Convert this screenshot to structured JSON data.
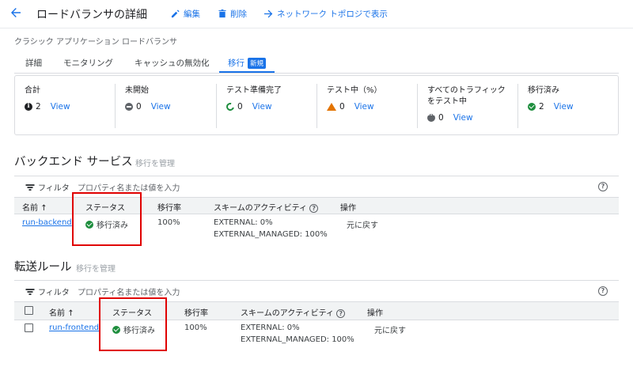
{
  "header": {
    "title": "ロードバランサの詳細",
    "edit_label": "編集",
    "delete_label": "削除",
    "topology_label": "ネットワーク トポロジで表示"
  },
  "subtitle": "クラシック アプリケーション ロードバランサ",
  "tabs": [
    {
      "label": "詳細"
    },
    {
      "label": "モニタリング"
    },
    {
      "label": "キャッシュの無効化"
    },
    {
      "label": "移行",
      "badge": "新規",
      "active": true
    }
  ],
  "summary": [
    {
      "title": "合計",
      "count": "2",
      "icon": "info-icon",
      "view": "View"
    },
    {
      "title": "未開始",
      "count": "0",
      "icon": "minus-circle-icon",
      "view": "View"
    },
    {
      "title": "テスト準備完了",
      "count": "0",
      "icon": "sync-icon",
      "view": "View"
    },
    {
      "title": "テスト中（%）",
      "count": "0",
      "icon": "warning-icon",
      "view": "View"
    },
    {
      "title_line1": "すべてのトラフィック",
      "title_line2": "をテスト中",
      "count": "0",
      "icon": "dots-circle-icon",
      "view": "View"
    },
    {
      "title": "移行済み",
      "count": "2",
      "icon": "check-circle-icon",
      "view": "View"
    }
  ],
  "backend": {
    "title": "バックエンド サービス",
    "manage": "移行を管理",
    "filter_label": "フィルタ",
    "filter_placeholder": "プロパティ名または値を入力",
    "columns": [
      "名前",
      "ステータス",
      "移行率",
      "スキームのアクティビティ",
      "操作"
    ],
    "rows": [
      {
        "name": "run-backend",
        "status": "移行済み",
        "rate": "100%",
        "scheme_1": "EXTERNAL: 0%",
        "scheme_2": "EXTERNAL_MANAGED: 100%",
        "action": "元に戻す"
      }
    ]
  },
  "forwarding": {
    "title": "転送ルール",
    "manage": "移行を管理",
    "filter_label": "フィルタ",
    "filter_placeholder": "プロパティ名または値を入力",
    "columns": [
      "名前",
      "ステータス",
      "移行率",
      "スキームのアクティビティ",
      "操作"
    ],
    "rows": [
      {
        "name": "run-frontend",
        "status": "移行済み",
        "rate": "100%",
        "scheme_1": "EXTERNAL: 0%",
        "scheme_2": "EXTERNAL_MANAGED: 100%",
        "action": "元に戻す"
      }
    ]
  },
  "colors": {
    "accent": "#1a73e8",
    "success": "#1e8e3e",
    "warning": "#e37400",
    "highlight": "#e00000"
  }
}
